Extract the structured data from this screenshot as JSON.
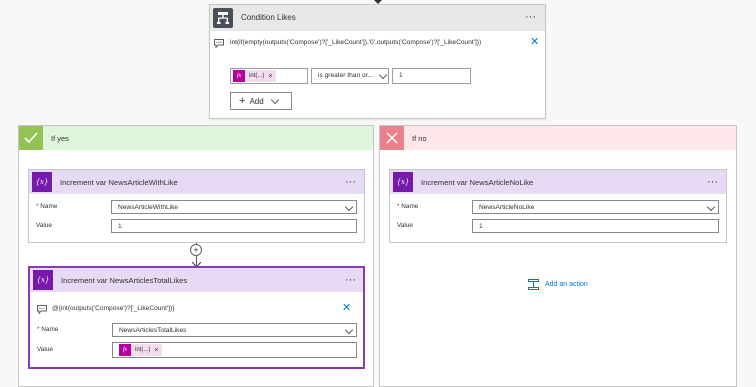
{
  "condition": {
    "title": "Condition Likes",
    "expression": "int(if(empty(outputs('Compose')?['_LikeCount']),'0',outputs('Compose')?['_LikeCount']))",
    "operand_token": "int(...)",
    "operator": "is greater than or...",
    "value": "1",
    "add_label": "Add"
  },
  "yes_branch": {
    "label": "If yes",
    "actions": [
      {
        "title": "Increment var NewsArticleWithLike",
        "name_label": "Name",
        "name_value": "NewsArticleWithLike",
        "value_label": "Value",
        "value": "1"
      },
      {
        "title": "Increment var NewsArticlesTotalLikes",
        "expression": "@{int(outputs('Compose')?['_LikeCount'])}",
        "name_label": "Name",
        "name_value": "NewsArticlesTotalLikes",
        "value_label": "Value",
        "value_token": "int(...)"
      }
    ]
  },
  "no_branch": {
    "label": "If no",
    "actions": [
      {
        "title": "Increment var NewsArticleNoLike",
        "name_label": "Name",
        "name_value": "NewsArticleNoLike",
        "value_label": "Value",
        "value": "1"
      }
    ],
    "add_action_label": "Add an action"
  },
  "common": {
    "more_glyph": "···",
    "close_glyph": "✕",
    "remove_glyph": "×",
    "required_mark": "*",
    "fx_glyph": "fx",
    "var_glyph": "{x}",
    "plus_glyph": "+"
  },
  "colors": {
    "condition_header": "#e8e8e8",
    "condition_icon": "#484f58",
    "yes_header": "#dff6dd",
    "yes_icon": "#92c353",
    "no_header": "#fde7e9",
    "no_icon": "#e8818b",
    "action_header": "#e6daf4",
    "variable_icon": "#7719aa",
    "expression_token": "#b4009e",
    "link": "#0078d4",
    "selected_border": "#8a3ab9"
  }
}
